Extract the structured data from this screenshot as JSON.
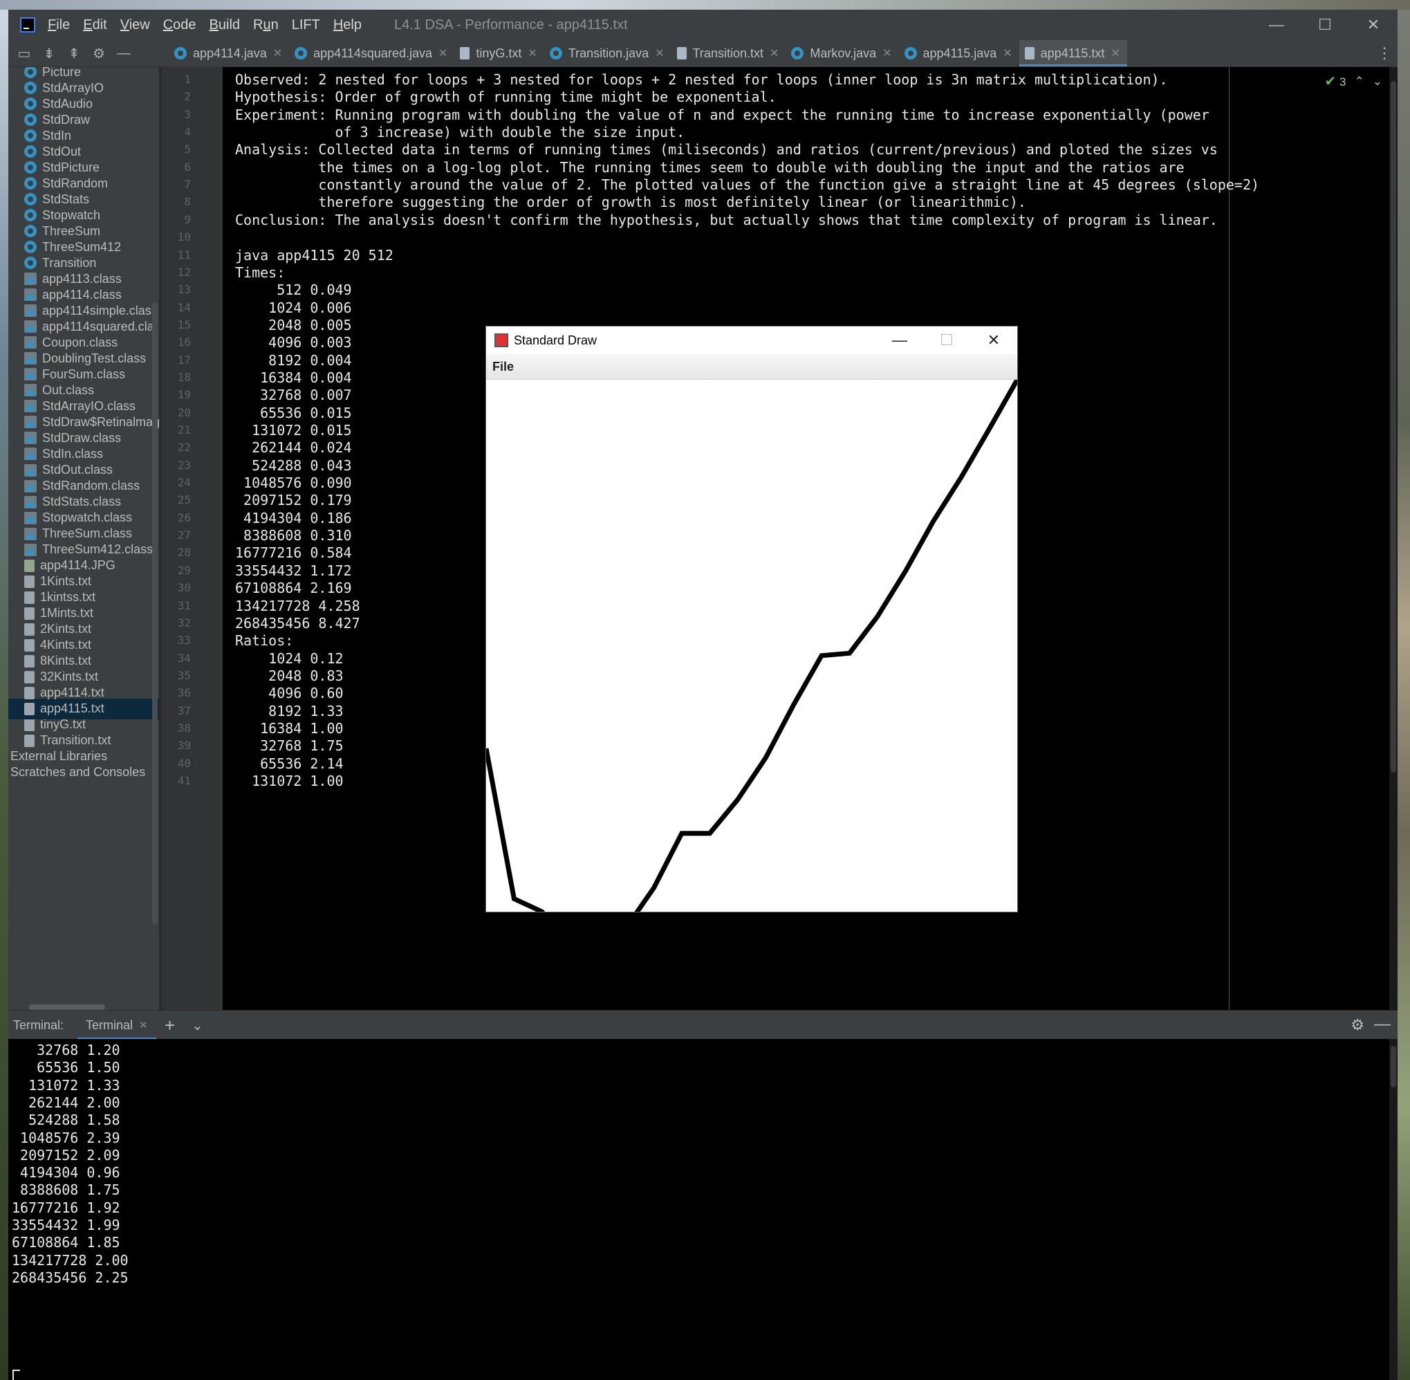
{
  "window": {
    "menu": [
      {
        "pre": "",
        "u": "F",
        "post": "ile"
      },
      {
        "pre": "",
        "u": "E",
        "post": "dit"
      },
      {
        "pre": "",
        "u": "V",
        "post": "iew"
      },
      {
        "pre": "",
        "u": "C",
        "post": "ode"
      },
      {
        "pre": "",
        "u": "B",
        "post": "uild"
      },
      {
        "pre": "R",
        "u": "u",
        "post": "n"
      },
      {
        "pre": "LIFT",
        "u": "",
        "post": ""
      },
      {
        "pre": "",
        "u": "H",
        "post": "elp"
      }
    ],
    "title": "L4.1 DSA - Performance - app4115.txt",
    "controls": {
      "minimize": "—",
      "maximize": "☐",
      "close": "✕"
    }
  },
  "tabs": [
    {
      "label": "app4114.java",
      "type": "java",
      "active": false
    },
    {
      "label": "app4114squared.java",
      "type": "java",
      "active": false
    },
    {
      "label": "tinyG.txt",
      "type": "txt",
      "active": false
    },
    {
      "label": "Transition.java",
      "type": "java",
      "active": false
    },
    {
      "label": "Transition.txt",
      "type": "txt",
      "active": false
    },
    {
      "label": "Markov.java",
      "type": "java",
      "active": false
    },
    {
      "label": "app4115.java",
      "type": "java",
      "active": false
    },
    {
      "label": "app4115.txt",
      "type": "txt",
      "active": true
    }
  ],
  "project": {
    "items": [
      {
        "label": "Picture",
        "icon": "class",
        "indent": 1
      },
      {
        "label": "StdArrayIO",
        "icon": "class",
        "indent": 1
      },
      {
        "label": "StdAudio",
        "icon": "class",
        "indent": 1
      },
      {
        "label": "StdDraw",
        "icon": "class",
        "indent": 1
      },
      {
        "label": "StdIn",
        "icon": "class",
        "indent": 1
      },
      {
        "label": "StdOut",
        "icon": "class",
        "indent": 1
      },
      {
        "label": "StdPicture",
        "icon": "class",
        "indent": 1
      },
      {
        "label": "StdRandom",
        "icon": "class",
        "indent": 1
      },
      {
        "label": "StdStats",
        "icon": "class",
        "indent": 1
      },
      {
        "label": "Stopwatch",
        "icon": "class",
        "indent": 1
      },
      {
        "label": "ThreeSum",
        "icon": "class",
        "indent": 1
      },
      {
        "label": "ThreeSum412",
        "icon": "class",
        "indent": 1
      },
      {
        "label": "Transition",
        "icon": "class",
        "indent": 1
      },
      {
        "label": "app4113.class",
        "icon": "binary",
        "indent": 1
      },
      {
        "label": "app4114.class",
        "icon": "binary",
        "indent": 1
      },
      {
        "label": "app4114simple.class",
        "icon": "binary",
        "indent": 1
      },
      {
        "label": "app4114squared.cla",
        "icon": "binary",
        "indent": 1
      },
      {
        "label": "Coupon.class",
        "icon": "binary",
        "indent": 1
      },
      {
        "label": "DoublingTest.class",
        "icon": "binary",
        "indent": 1
      },
      {
        "label": "FourSum.class",
        "icon": "binary",
        "indent": 1
      },
      {
        "label": "Out.class",
        "icon": "binary",
        "indent": 1
      },
      {
        "label": "StdArrayIO.class",
        "icon": "binary",
        "indent": 1
      },
      {
        "label": "StdDraw$RetinalmageIcon",
        "icon": "binary",
        "indent": 1
      },
      {
        "label": "StdDraw.class",
        "icon": "binary",
        "indent": 1
      },
      {
        "label": "StdIn.class",
        "icon": "binary",
        "indent": 1
      },
      {
        "label": "StdOut.class",
        "icon": "binary",
        "indent": 1
      },
      {
        "label": "StdRandom.class",
        "icon": "binary",
        "indent": 1
      },
      {
        "label": "StdStats.class",
        "icon": "binary",
        "indent": 1
      },
      {
        "label": "Stopwatch.class",
        "icon": "binary",
        "indent": 1
      },
      {
        "label": "ThreeSum.class",
        "icon": "binary",
        "indent": 1
      },
      {
        "label": "ThreeSum412.class",
        "icon": "binary",
        "indent": 1
      },
      {
        "label": "app4114.JPG",
        "icon": "image",
        "indent": 1
      },
      {
        "label": "1Kints.txt",
        "icon": "file",
        "indent": 1
      },
      {
        "label": "1kintss.txt",
        "icon": "file",
        "indent": 1
      },
      {
        "label": "1Mints.txt",
        "icon": "file",
        "indent": 1
      },
      {
        "label": "2Kints.txt",
        "icon": "file",
        "indent": 1
      },
      {
        "label": "4Kints.txt",
        "icon": "file",
        "indent": 1
      },
      {
        "label": "8Kints.txt",
        "icon": "file",
        "indent": 1
      },
      {
        "label": "32Kints.txt",
        "icon": "file",
        "indent": 1
      },
      {
        "label": "app4114.txt",
        "icon": "file",
        "indent": 1
      },
      {
        "label": "app4115.txt",
        "icon": "file",
        "indent": 1,
        "selected": true
      },
      {
        "label": "tinyG.txt",
        "icon": "file",
        "indent": 1
      },
      {
        "label": "Transition.txt",
        "icon": "file",
        "indent": 1
      },
      {
        "label": "External Libraries",
        "icon": "",
        "indent": 0
      },
      {
        "label": "Scratches and Consoles",
        "icon": "",
        "indent": 0
      }
    ]
  },
  "editor": {
    "inspection_count": "3",
    "lines": [
      "Observed: 2 nested for loops + 3 nested for loops + 2 nested for loops (inner loop is 3n matrix multiplication).",
      "Hypothesis: Order of growth of running time might be exponential.",
      "Experiment: Running program with doubling the value of n and expect the running time to increase exponentially (power",
      "            of 3 increase) with double the size input.",
      "Analysis: Collected data in terms of running times (miliseconds) and ratios (current/previous) and ploted the sizes vs",
      "          the times on a log-log plot. The running times seem to double with doubling the input and the ratios are",
      "          constantly around the value of 2. The plotted values of the function give a straight line at 45 degrees (slope=2)",
      "          therefore suggesting the order of growth is most definitely linear (or linearithmic).",
      "Conclusion: The analysis doesn't confirm the hypothesis, but actually shows that time complexity of program is linear.",
      "",
      "java app4115 20 512",
      "Times:",
      "     512 0.049",
      "    1024 0.006",
      "    2048 0.005",
      "    4096 0.003",
      "    8192 0.004",
      "   16384 0.004",
      "   32768 0.007",
      "   65536 0.015",
      "  131072 0.015",
      "  262144 0.024",
      "  524288 0.043",
      " 1048576 0.090",
      " 2097152 0.179",
      " 4194304 0.186",
      " 8388608 0.310",
      "16777216 0.584",
      "33554432 1.172",
      "67108864 2.169",
      "134217728 4.258",
      "268435456 8.427",
      "Ratios:",
      "    1024 0.12",
      "    2048 0.83",
      "    4096 0.60",
      "    8192 1.33",
      "   16384 1.00",
      "   32768 1.75",
      "   65536 2.14",
      "  131072 1.00"
    ]
  },
  "standard_draw": {
    "title": "Standard Draw",
    "menu_file": "File",
    "controls": {
      "minimize": "—",
      "maximize": "☐",
      "close": "✕"
    },
    "plot_log2_n": [
      9,
      10,
      11,
      12,
      13,
      14,
      15,
      16,
      17,
      18,
      19,
      20,
      21,
      22,
      23,
      24,
      25,
      26,
      27,
      28
    ],
    "plot_log2_t": [
      -4.35,
      -7.38,
      -7.64,
      -8.38,
      -7.97,
      -7.97,
      -7.16,
      -6.06,
      -6.06,
      -5.38,
      -4.54,
      -3.47,
      -2.48,
      -2.43,
      -1.69,
      -0.78,
      0.23,
      1.12,
      2.09,
      3.08
    ]
  },
  "terminal": {
    "label": "Terminal:",
    "tab": "Terminal",
    "lines": [
      "   32768 1.20",
      "   65536 1.50",
      "  131072 1.33",
      "  262144 2.00",
      "  524288 1.58",
      " 1048576 2.39",
      " 2097152 2.09",
      " 4194304 0.96",
      " 8388608 1.75",
      "16777216 1.92",
      "33554432 1.99",
      "67108864 1.85",
      "134217728 2.00",
      "268435456 2.25"
    ]
  }
}
